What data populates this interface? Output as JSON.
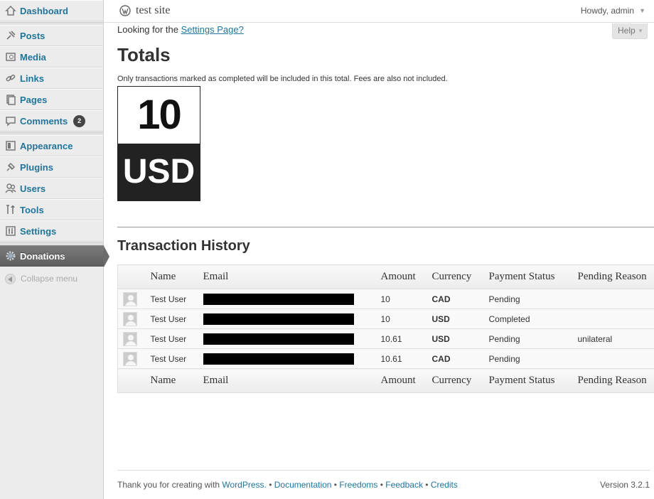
{
  "colors": {
    "link": "#21759b",
    "sidebar_bg": "#ececec",
    "active_bg": "#6c6c6c",
    "total_dark": "#222222"
  },
  "sidebar": {
    "items": [
      {
        "label": "Dashboard",
        "icon": "dashboard-icon"
      },
      {
        "label": "Posts",
        "icon": "pin-icon"
      },
      {
        "label": "Media",
        "icon": "media-icon"
      },
      {
        "label": "Links",
        "icon": "link-icon"
      },
      {
        "label": "Pages",
        "icon": "pages-icon"
      },
      {
        "label": "Comments",
        "icon": "comment-icon",
        "badge": "2"
      },
      {
        "label": "Appearance",
        "icon": "appearance-icon"
      },
      {
        "label": "Plugins",
        "icon": "plug-icon"
      },
      {
        "label": "Users",
        "icon": "users-icon"
      },
      {
        "label": "Tools",
        "icon": "tools-icon"
      },
      {
        "label": "Settings",
        "icon": "settings-icon"
      },
      {
        "label": "Donations",
        "icon": "gear-icon",
        "active": true
      }
    ],
    "collapse_label": "Collapse menu"
  },
  "header": {
    "site_title": "test site",
    "howdy": "Howdy, admin",
    "help_label": "Help"
  },
  "main": {
    "looking_prefix": "Looking for the ",
    "settings_link": "Settings Page?",
    "totals_title": "Totals",
    "totals_note": "Only transactions marked as completed will be included in this total. Fees are also not included.",
    "total_amount": "10",
    "total_currency": "USD",
    "history_title": "Transaction History",
    "columns": [
      "Name",
      "Email",
      "Amount",
      "Currency",
      "Payment Status",
      "Pending Reason"
    ],
    "rows": [
      {
        "name": "Test User",
        "amount": "10",
        "currency": "CAD",
        "status": "Pending",
        "reason": ""
      },
      {
        "name": "Test User",
        "amount": "10",
        "currency": "USD",
        "status": "Completed",
        "reason": ""
      },
      {
        "name": "Test User",
        "amount": "10.61",
        "currency": "USD",
        "status": "Pending",
        "reason": "unilateral"
      },
      {
        "name": "Test User",
        "amount": "10.61",
        "currency": "CAD",
        "status": "Pending",
        "reason": ""
      }
    ]
  },
  "footer": {
    "thanks": "Thank you for creating with ",
    "links": [
      "WordPress.",
      "Documentation",
      "Freedoms",
      "Feedback",
      "Credits"
    ],
    "separator": " • ",
    "version": "Version 3.2.1"
  }
}
